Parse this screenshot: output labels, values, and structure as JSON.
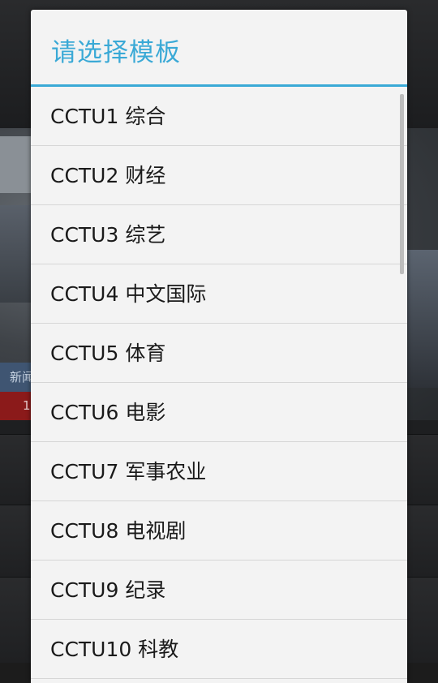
{
  "background": {
    "news_label": "新闻",
    "red_bar_text": "1"
  },
  "dialog": {
    "title": "请选择模板",
    "items": [
      {
        "label": "CCTU1 综合"
      },
      {
        "label": "CCTU2 财经"
      },
      {
        "label": "CCTU3 综艺"
      },
      {
        "label": "CCTU4 中文国际"
      },
      {
        "label": "CCTU5 体育"
      },
      {
        "label": "CCTU6 电影"
      },
      {
        "label": "CCTU7 军事农业"
      },
      {
        "label": "CCTU8 电视剧"
      },
      {
        "label": "CCTU9 纪录"
      },
      {
        "label": "CCTU10 科教"
      }
    ]
  },
  "colors": {
    "accent": "#3aa9d6",
    "dialog_bg": "#f3f3f3",
    "divider": "#d6d6d6",
    "text": "#1a1a1a"
  }
}
